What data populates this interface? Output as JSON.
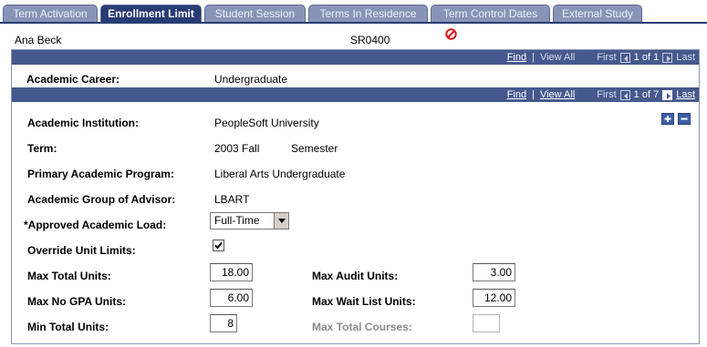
{
  "tabs": [
    {
      "label": "Term Activation",
      "active": false
    },
    {
      "label": "Enrollment Limit",
      "active": true
    },
    {
      "label": "Student Session",
      "active": false
    },
    {
      "label": "Terms In Residence",
      "active": false
    },
    {
      "label": "Term Control Dates",
      "active": false
    },
    {
      "label": "External Study",
      "active": false
    }
  ],
  "header": {
    "name": "Ana Beck",
    "id": "SR0400"
  },
  "career_nav": {
    "find": "Find",
    "view_all": "View All",
    "first": "First",
    "position": "1 of 1",
    "last": "Last"
  },
  "career": {
    "label": "Academic Career:",
    "value": "Undergraduate"
  },
  "term_nav": {
    "find": "Find",
    "view_all": "View All",
    "first": "First",
    "position": "1 of 7",
    "last": "Last"
  },
  "fields": {
    "institution": {
      "label": "Academic Institution:",
      "value": "PeopleSoft University"
    },
    "term": {
      "label": "Term:",
      "value": "2003 Fall",
      "desc": "Semester"
    },
    "program": {
      "label": "Primary Academic Program:",
      "value": "Liberal Arts Undergraduate"
    },
    "advisor_group": {
      "label": "Academic Group of Advisor:",
      "value": "LBART"
    },
    "load": {
      "label": "*Approved Academic Load:",
      "value": "Full-Time"
    },
    "override": {
      "label": "Override Unit Limits:",
      "checked": true
    },
    "max_total": {
      "label": "Max Total Units:",
      "value": "18.00"
    },
    "max_nogpa": {
      "label": "Max No GPA Units:",
      "value": "6.00"
    },
    "min_total": {
      "label": "Min Total Units:",
      "value": "8"
    },
    "max_audit": {
      "label": "Max Audit Units:",
      "value": "3.00"
    },
    "max_waitlist": {
      "label": "Max Wait List Units:",
      "value": "12.00"
    },
    "max_courses": {
      "label": "Max Total Courses:",
      "value": ""
    }
  },
  "colors": {
    "tab_active": "#283b74",
    "tab_inactive": "#8794b8",
    "bar": "#46598e"
  }
}
